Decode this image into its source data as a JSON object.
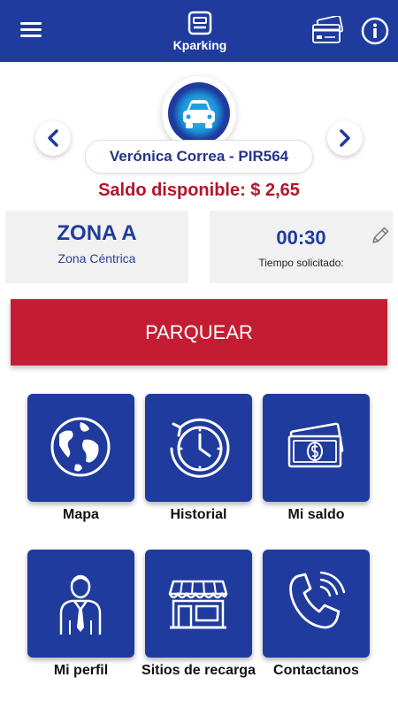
{
  "header": {
    "app_name": "Kparking",
    "colors": {
      "primary": "#1f3b9e",
      "accent_red": "#c41d33"
    }
  },
  "vehicle": {
    "label": "Verónica Correa - PIR564"
  },
  "balance": {
    "text": "Saldo disponible: $ 2,65"
  },
  "zone": {
    "title": "ZONA A",
    "subtitle": "Zona Céntrica"
  },
  "time": {
    "value": "00:30",
    "label": "Tiempo solicitado:"
  },
  "park_button": {
    "label": "PARQUEAR"
  },
  "menu": {
    "items": [
      {
        "label": "Mapa",
        "icon": "globe-icon"
      },
      {
        "label": "Historial",
        "icon": "history-clock-icon"
      },
      {
        "label": "Mi saldo",
        "icon": "money-icon"
      },
      {
        "label": "Mi perfil",
        "icon": "user-profile-icon"
      },
      {
        "label": "Sitios de recarga",
        "icon": "store-icon"
      },
      {
        "label": "Contactanos",
        "icon": "phone-icon"
      }
    ]
  }
}
